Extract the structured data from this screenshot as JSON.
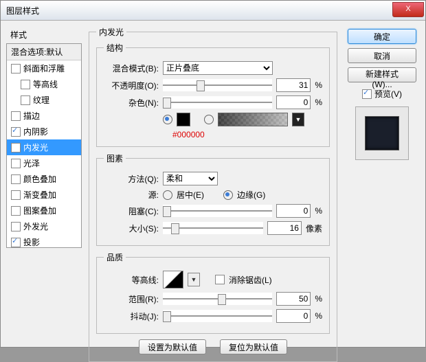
{
  "title": "图层样式",
  "close": "X",
  "left": {
    "header": "样式",
    "blend_header": "混合选项:默认",
    "items": [
      {
        "label": "斜面和浮雕",
        "checked": false,
        "indent": false
      },
      {
        "label": "等高线",
        "checked": false,
        "indent": true
      },
      {
        "label": "纹理",
        "checked": false,
        "indent": true
      },
      {
        "label": "描边",
        "checked": false,
        "indent": false
      },
      {
        "label": "内阴影",
        "checked": true,
        "indent": false
      },
      {
        "label": "内发光",
        "checked": true,
        "indent": false,
        "selected": true
      },
      {
        "label": "光泽",
        "checked": false,
        "indent": false
      },
      {
        "label": "颜色叠加",
        "checked": false,
        "indent": false
      },
      {
        "label": "渐变叠加",
        "checked": false,
        "indent": false
      },
      {
        "label": "图案叠加",
        "checked": false,
        "indent": false
      },
      {
        "label": "外发光",
        "checked": false,
        "indent": false
      },
      {
        "label": "投影",
        "checked": true,
        "indent": false
      }
    ]
  },
  "main": {
    "title": "内发光",
    "structure": {
      "legend": "结构",
      "blend_label": "混合模式(B):",
      "blend_value": "正片叠底",
      "opacity_label": "不透明度(O):",
      "opacity_value": "31",
      "opacity_unit": "%",
      "noise_label": "杂色(N):",
      "noise_value": "0",
      "noise_unit": "%",
      "hex": "#000000"
    },
    "elements": {
      "legend": "图素",
      "tech_label": "方法(Q):",
      "tech_value": "柔和",
      "source_label": "源:",
      "center_label": "居中(E)",
      "edge_label": "边缘(G)",
      "choke_label": "阻塞(C):",
      "choke_value": "0",
      "choke_unit": "%",
      "size_label": "大小(S):",
      "size_value": "16",
      "size_unit": "像素"
    },
    "quality": {
      "legend": "品质",
      "contour_label": "等高线:",
      "aa_label": "消除锯齿(L)",
      "range_label": "范围(R):",
      "range_value": "50",
      "range_unit": "%",
      "jitter_label": "抖动(J):",
      "jitter_value": "0",
      "jitter_unit": "%"
    },
    "buttons": {
      "set_default": "设置为默认值",
      "reset_default": "复位为默认值"
    }
  },
  "right": {
    "ok": "确定",
    "cancel": "取消",
    "new_style": "新建样式(W)...",
    "preview": "预览(V)"
  }
}
